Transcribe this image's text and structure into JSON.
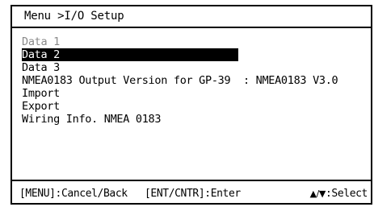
{
  "title": "Menu >I/O Setup",
  "menu": {
    "items": [
      {
        "label": "Data 1",
        "state": "disabled"
      },
      {
        "label": "Data 2",
        "state": "selected"
      },
      {
        "label": "Data 3",
        "state": "normal"
      },
      {
        "label": "NMEA0183 Output Version for GP-39  : NMEA0183 V3.0",
        "state": "normal"
      },
      {
        "label": "Import",
        "state": "normal"
      },
      {
        "label": "Export",
        "state": "normal"
      },
      {
        "label": "Wiring Info. NMEA 0183",
        "state": "normal"
      }
    ]
  },
  "footer": {
    "cancel": "[MENU]:Cancel/Back",
    "enter": "[ENT/CNTR]:Enter",
    "select_arrows": "▲/▼",
    "select_label": ":Select"
  },
  "colors": {
    "text": "#000000",
    "disabled": "#8a8a8a",
    "highlight_bg": "#000000",
    "highlight_fg": "#ffffff"
  }
}
